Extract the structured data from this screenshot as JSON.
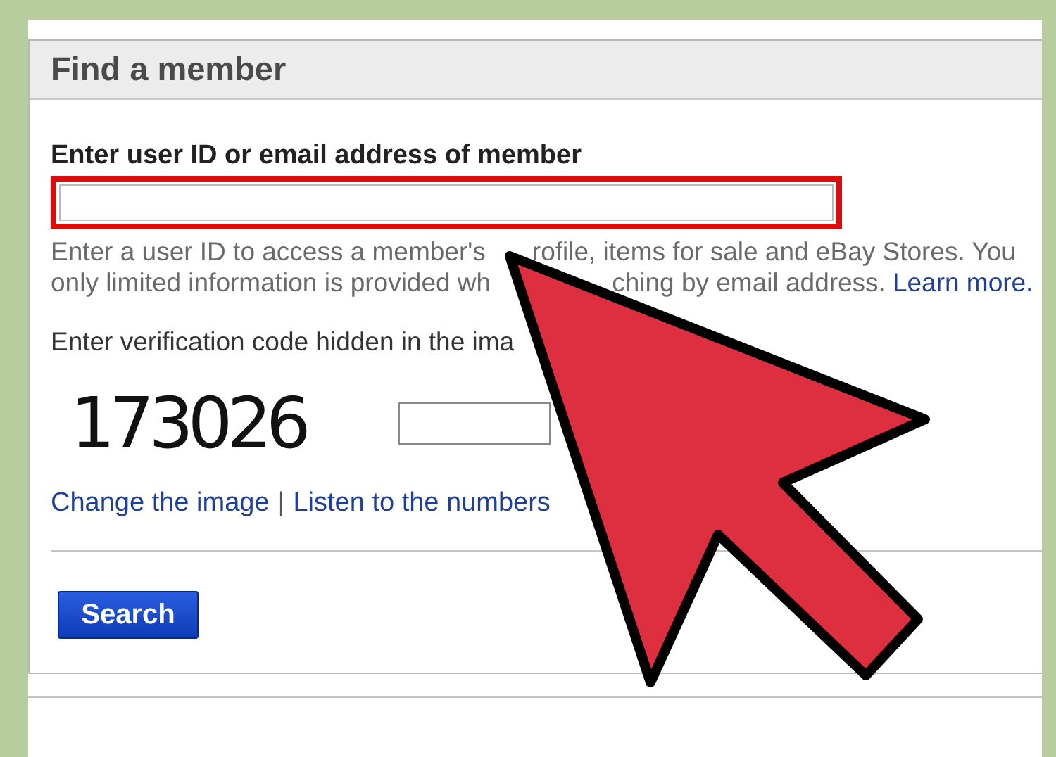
{
  "panel": {
    "title": "Find a member",
    "member_field": {
      "label": "Enter user ID or email address of member",
      "highlighted": true
    },
    "help_lines": [
      [
        "Enter a user ID to access a member's",
        "rofile, items for sale and eBay Stores. You"
      ],
      [
        "only limited information is provided wh",
        "ching by email address."
      ]
    ],
    "help_link": "Learn more.",
    "verification": {
      "label": "Enter verification code hidden in the ima",
      "code": "173026"
    },
    "links": [
      {
        "text": "Change the image"
      },
      {
        "text": "Listen to the numbers"
      }
    ],
    "separator": "|",
    "button": "Search"
  },
  "overlay": {
    "kind": "arrow"
  }
}
